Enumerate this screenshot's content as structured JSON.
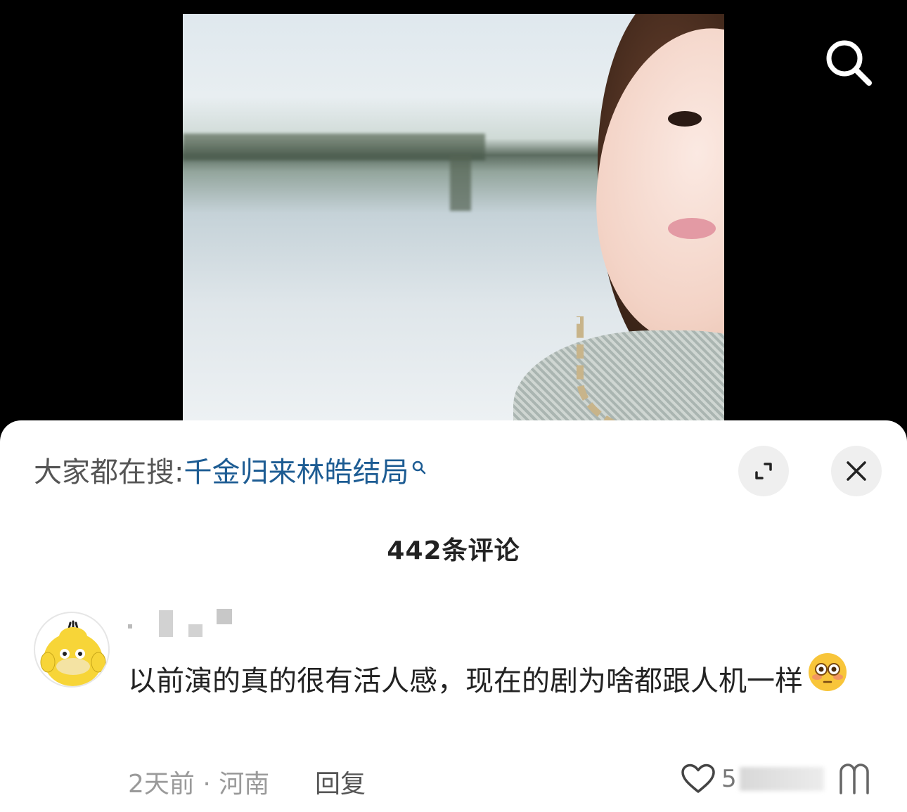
{
  "video": {
    "search_icon": "search-icon"
  },
  "sheet": {
    "trending_prefix": "大家都在搜:",
    "trending_query": "千金归来林皓结局",
    "expand_icon": "expand-icon",
    "close_icon": "close-icon",
    "comment_count": "442条评论"
  },
  "comment": {
    "text": "以前演的真的很有活人感，现在的剧为啥都跟人机一样",
    "emoji": "flushed-face-emoji",
    "time": "2天前",
    "location": "河南",
    "meta": "2天前 · 河南",
    "reply_label": "回复",
    "like_count_visible": "5",
    "like_icon": "heart-icon",
    "dislike_icon": "dislike-icon"
  },
  "colors": {
    "link_blue": "#1d5c93",
    "sheet_bg": "#ffffff",
    "circle_btn_bg": "#efefef"
  }
}
